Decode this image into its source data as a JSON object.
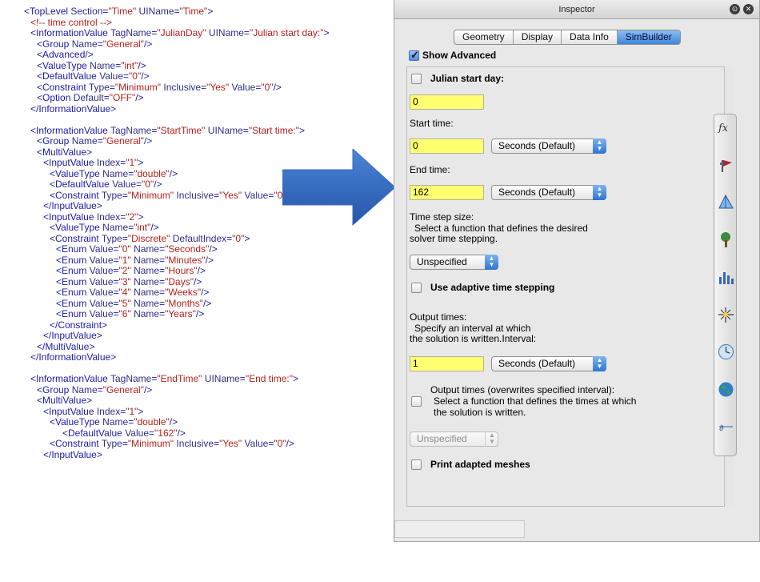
{
  "xml_lines": [
    {
      "i": 0,
      "t": "<TopLevel Section=\"Time\" UIName=\"Time\">"
    },
    {
      "i": 1,
      "t": "<!-- time control -->",
      "c": true
    },
    {
      "i": 1,
      "t": "<InformationValue TagName=\"JulianDay\" UIName=\"Julian start day:\">"
    },
    {
      "i": 2,
      "t": "<Group Name=\"General\"/>"
    },
    {
      "i": 2,
      "t": "<Advanced/>"
    },
    {
      "i": 2,
      "t": "<ValueType Name=\"int\"/>"
    },
    {
      "i": 2,
      "t": "<DefaultValue Value=\"0\"/>"
    },
    {
      "i": 2,
      "t": "<Constraint Type=\"Minimum\" Inclusive=\"Yes\" Value=\"0\"/>"
    },
    {
      "i": 2,
      "t": "<Option Default=\"OFF\"/>"
    },
    {
      "i": 1,
      "t": "</InformationValue>"
    },
    {
      "gap": true
    },
    {
      "i": 1,
      "t": "<InformationValue TagName=\"StartTime\" UIName=\"Start time:\">"
    },
    {
      "i": 2,
      "t": "<Group Name=\"General\"/>"
    },
    {
      "i": 2,
      "t": "<MultiValue>"
    },
    {
      "i": 3,
      "t": "<InputValue Index=\"1\">"
    },
    {
      "i": 4,
      "t": "<ValueType Name=\"double\"/>"
    },
    {
      "i": 4,
      "t": "<DefaultValue Value=\"0\"/>"
    },
    {
      "i": 4,
      "t": "<Constraint Type=\"Minimum\" Inclusive=\"Yes\" Value=\"0\"/>"
    },
    {
      "i": 3,
      "t": "</InputValue>"
    },
    {
      "i": 3,
      "t": "<InputValue Index=\"2\">"
    },
    {
      "i": 4,
      "t": "<ValueType Name=\"int\"/>"
    },
    {
      "i": 4,
      "t": "<Constraint Type=\"Discrete\" DefaultIndex=\"0\">"
    },
    {
      "i": 5,
      "t": "<Enum Value=\"0\" Name=\"Seconds\"/>"
    },
    {
      "i": 5,
      "t": "<Enum Value=\"1\" Name=\"Minutes\"/>"
    },
    {
      "i": 5,
      "t": "<Enum Value=\"2\" Name=\"Hours\"/>"
    },
    {
      "i": 5,
      "t": "<Enum Value=\"3\" Name=\"Days\"/>"
    },
    {
      "i": 5,
      "t": "<Enum Value=\"4\" Name=\"Weeks\"/>"
    },
    {
      "i": 5,
      "t": "<Enum Value=\"5\" Name=\"Months\"/>"
    },
    {
      "i": 5,
      "t": "<Enum Value=\"6\" Name=\"Years\"/>"
    },
    {
      "i": 4,
      "t": "</Constraint>"
    },
    {
      "i": 3,
      "t": "</InputValue>"
    },
    {
      "i": 2,
      "t": "</MultiValue>"
    },
    {
      "i": 1,
      "t": "</InformationValue>"
    },
    {
      "gap": true
    },
    {
      "i": 1,
      "t": "<InformationValue TagName=\"EndTime\" UIName=\"End time:\">"
    },
    {
      "i": 2,
      "t": "<Group Name=\"General\"/>"
    },
    {
      "i": 2,
      "t": "<MultiValue>"
    },
    {
      "i": 3,
      "t": "<InputValue Index=\"1\">"
    },
    {
      "i": 4,
      "t": "<ValueType Name=\"double\"/>"
    },
    {
      "i": 6,
      "t": "<DefaultValue Value=\"162\"/>"
    },
    {
      "i": 4,
      "t": "<Constraint Type=\"Minimum\" Inclusive=\"Yes\" Value=\"0\"/>"
    },
    {
      "i": 3,
      "t": "</InputValue>"
    }
  ],
  "inspector": {
    "title": "Inspector",
    "tabs": [
      "Geometry",
      "Display",
      "Data Info",
      "SimBuilder"
    ],
    "active_tab": "SimBuilder",
    "show_advanced_label": "Show Advanced",
    "show_advanced_checked": true,
    "julian_label": "Julian start day:",
    "julian_value": "0",
    "start_time_label": "Start time:",
    "start_time_value": "0",
    "start_time_unit": "Seconds  (Default)",
    "end_time_label": "End time:",
    "end_time_value": "162",
    "end_time_unit": "Seconds  (Default)",
    "time_step_label": "Time step size:",
    "time_step_desc_1": "Select a function that defines the desired",
    "time_step_desc_2": "solver time stepping.",
    "time_step_select": "Unspecified",
    "adaptive_label": "Use adaptive time stepping",
    "output_times_label": "Output times:",
    "output_times_desc_1": "Specify an interval at which",
    "output_times_desc_2": "the solution is written.Interval:",
    "output_interval_value": "1",
    "output_interval_unit": "Seconds  (Default)",
    "output_overwrite_label_1": "Output times (overwrites specified interval):",
    "output_overwrite_label_2": "Select a function that defines the times at which",
    "output_overwrite_label_3": "the solution is written.",
    "output_func_select": "Unspecified",
    "print_meshes_label": "Print adapted meshes",
    "strip_icons": [
      "function-icon",
      "boundary-flag-icon",
      "geometry-prism-icon",
      "tree-icon",
      "bar-chart-icon",
      "sparkle-icon",
      "clock-icon",
      "globe-icon",
      "equation-icon"
    ],
    "colors": {
      "yellow_field": "#ffff70",
      "accent": "#3f86db",
      "arrow": "#2e62b8"
    }
  }
}
